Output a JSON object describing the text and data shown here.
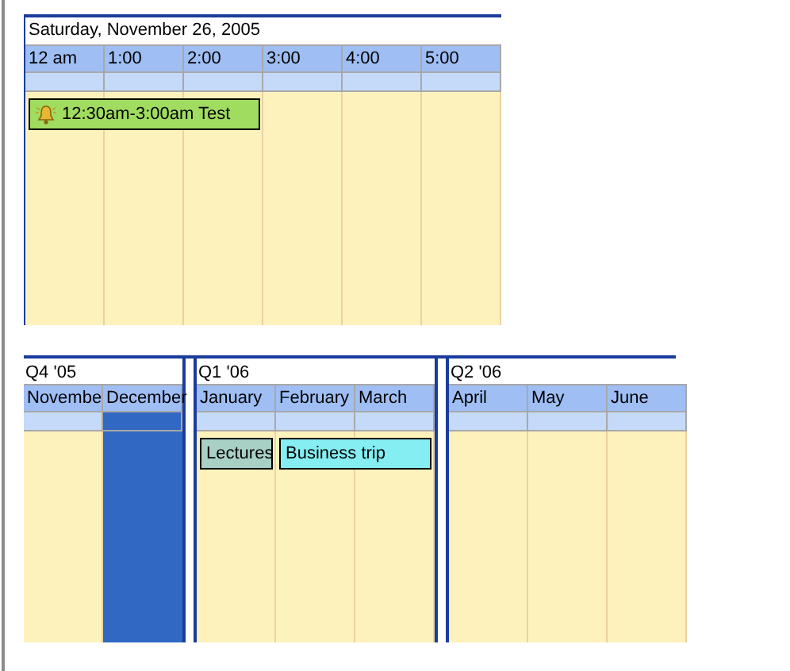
{
  "day_view": {
    "date": "Saturday, November 26, 2005",
    "hours": [
      "12 am",
      "1:00",
      "2:00",
      "3:00",
      "4:00",
      "5:00"
    ],
    "events": [
      {
        "text": "12:30am-3:00am Test",
        "reminder": true,
        "color": "#a0dc60"
      }
    ]
  },
  "quarters": [
    {
      "label": "Q4 '05",
      "months": [
        {
          "name": "Novembe",
          "selected": false
        },
        {
          "name": "December",
          "selected": true
        }
      ]
    },
    {
      "label": "Q1 '06",
      "months": [
        {
          "name": "January",
          "selected": false
        },
        {
          "name": "February",
          "selected": false
        },
        {
          "name": "March",
          "selected": false
        }
      ],
      "events": [
        {
          "text": "Lectures",
          "color": "#a8d0c4"
        },
        {
          "text": "Business trip",
          "color": "#84eef2"
        }
      ]
    },
    {
      "label": "Q2 '06",
      "months": [
        {
          "name": "April",
          "selected": false
        },
        {
          "name": "May",
          "selected": false
        },
        {
          "name": "June",
          "selected": false
        }
      ]
    }
  ]
}
